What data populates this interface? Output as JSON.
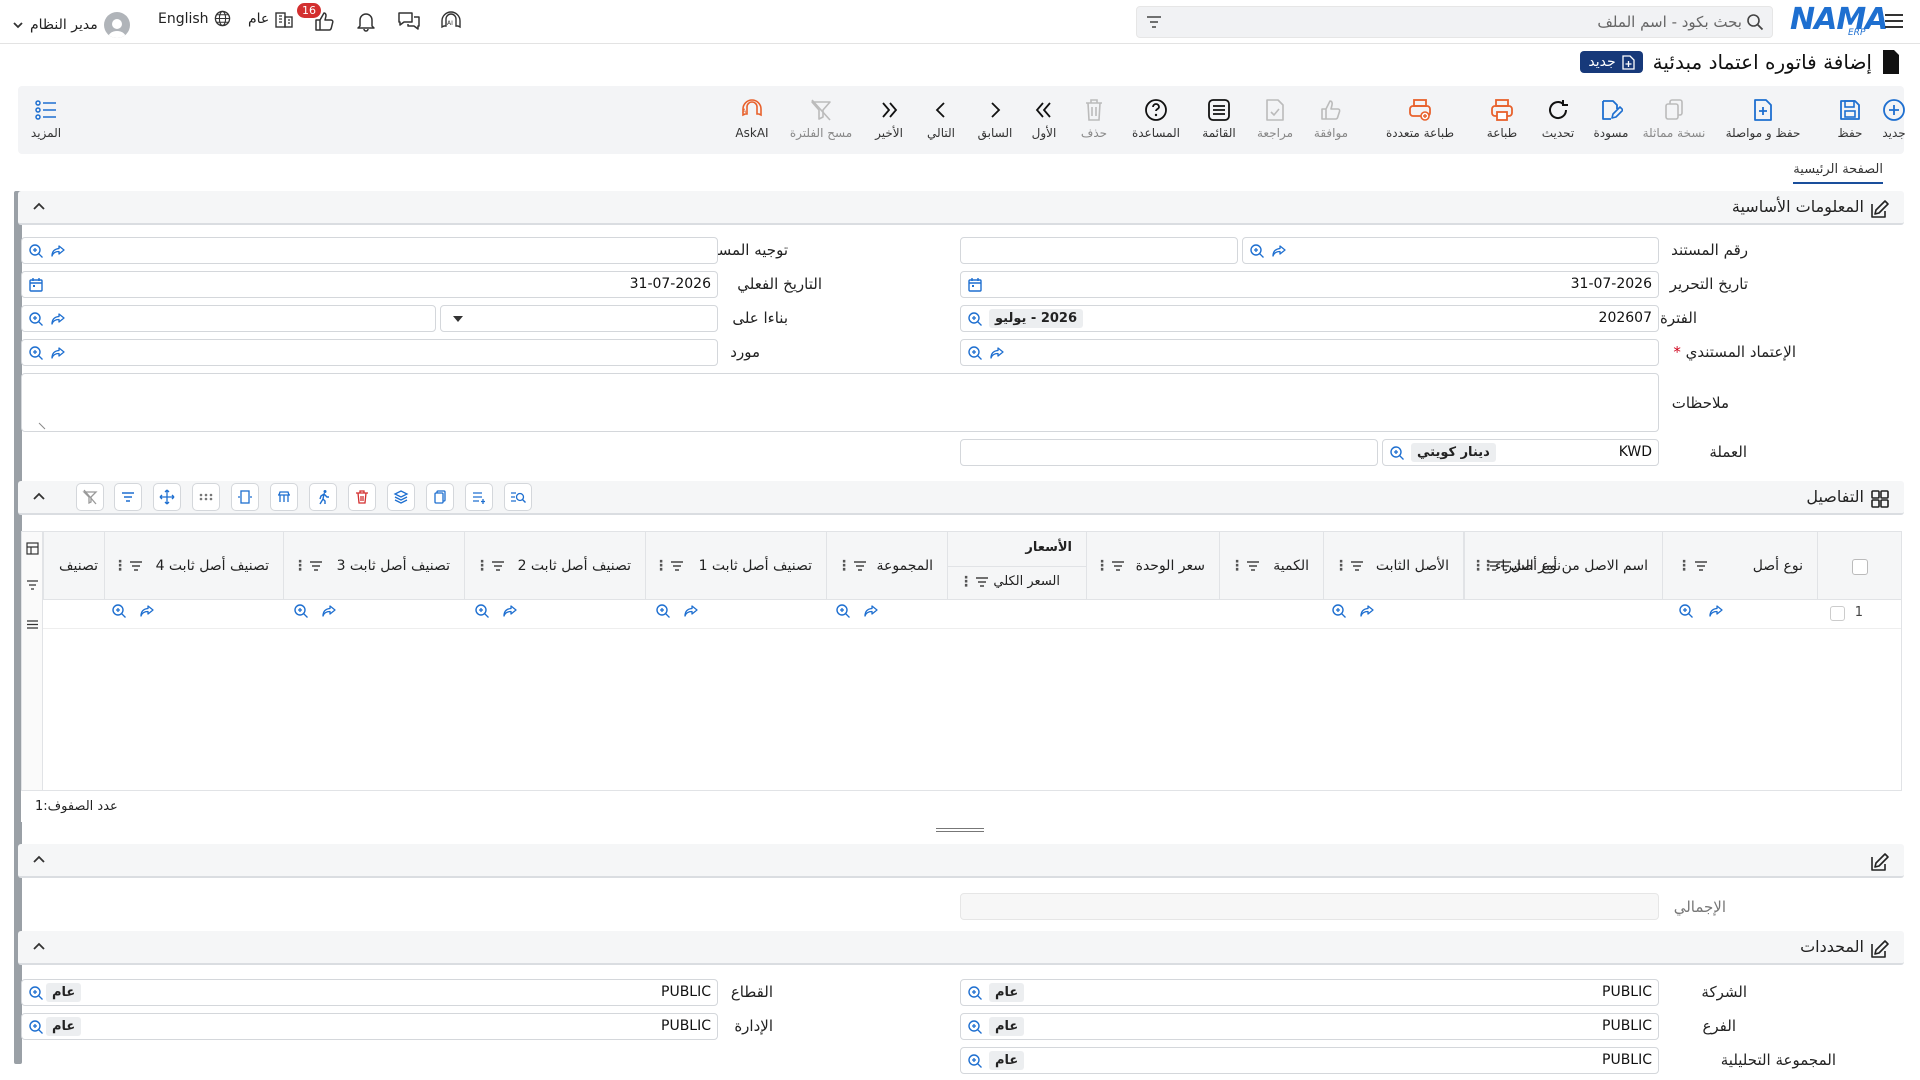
{
  "topbar": {
    "search_placeholder": "بحث بكود - اسم الملف",
    "brand": "NAMA",
    "brand_sub": "ERP",
    "user_name": "مدير النظام",
    "language": "English",
    "scope": "عام",
    "notification_count": "16"
  },
  "title": {
    "text": "إضافة فاتوره اعتماد مبدئية",
    "badge": "جديد"
  },
  "toolbar": {
    "new": "جديد",
    "save": "حفظ",
    "save_continue": "حفظ و مواصلة",
    "copy": "نسخة مماثلة",
    "draft": "مسودة",
    "refresh": "تحديث",
    "print": "طباعة",
    "multi_print": "طباعة متعددة",
    "approve": "موافقة",
    "review": "مراجعة",
    "list": "القائمة",
    "help": "المساعدة",
    "delete": "حذف",
    "first": "الأول",
    "prev": "السابق",
    "next": "التالي",
    "last": "الأخير",
    "clear_filter": "مسح الفلترة",
    "askai": "AskAI",
    "more": "المزيد"
  },
  "tabs": {
    "main": "الصفحة الرئيسية"
  },
  "basic": {
    "title": "المعلومات الأساسية",
    "doc_number_label": "رقم المستند",
    "doc_direction_label": "توجيه المستند",
    "edit_date_label": "تاريخ التحرير",
    "edit_date": "31-07-2026",
    "actual_date_label": "التاريخ الفعلي",
    "actual_date": "31-07-2026",
    "period_label": "الفترة",
    "period_code": "202607",
    "period_name": "2026 - يوليو",
    "based_on_label": "بناءا على",
    "doc_approval_label": "الإعتماد المستندي",
    "required_mark": "*",
    "supplier_label": "مورد",
    "notes_label": "ملاحظات",
    "currency_label": "العملة",
    "currency_code": "KWD",
    "currency_name": "دينار كويتي"
  },
  "details": {
    "title": "التفاصيل",
    "columns": {
      "asset_type": "نوع أصل",
      "po_asset_name": "اسم الاصل من أمر الشراء",
      "fixed_asset": "الأصل الثابت",
      "quantity": "الكمية",
      "unit_price": "سعر الوحدة",
      "prices_group": "الأسعار",
      "total_price": "السعر الكلي",
      "group": "المجموعة",
      "cls1": "تصنيف أصل ثابت 1",
      "cls2": "تصنيف أصل ثابت 2",
      "cls3": "تصنيف أصل ثابت 3",
      "cls4": "تصنيف أصل ثابت 4",
      "cls5": "تصنيف"
    },
    "row_number": "1",
    "row_count": "عدد الصفوف:1"
  },
  "totals": {
    "total_label": "الإجمالي"
  },
  "dims": {
    "title": "المحددات",
    "company_label": "الشركة",
    "sector_label": "القطاع",
    "branch_label": "الفرع",
    "department_label": "الإدارة",
    "analytic_label": "المجموعة التحليلية",
    "value": "PUBLIC",
    "chip": "عام"
  }
}
